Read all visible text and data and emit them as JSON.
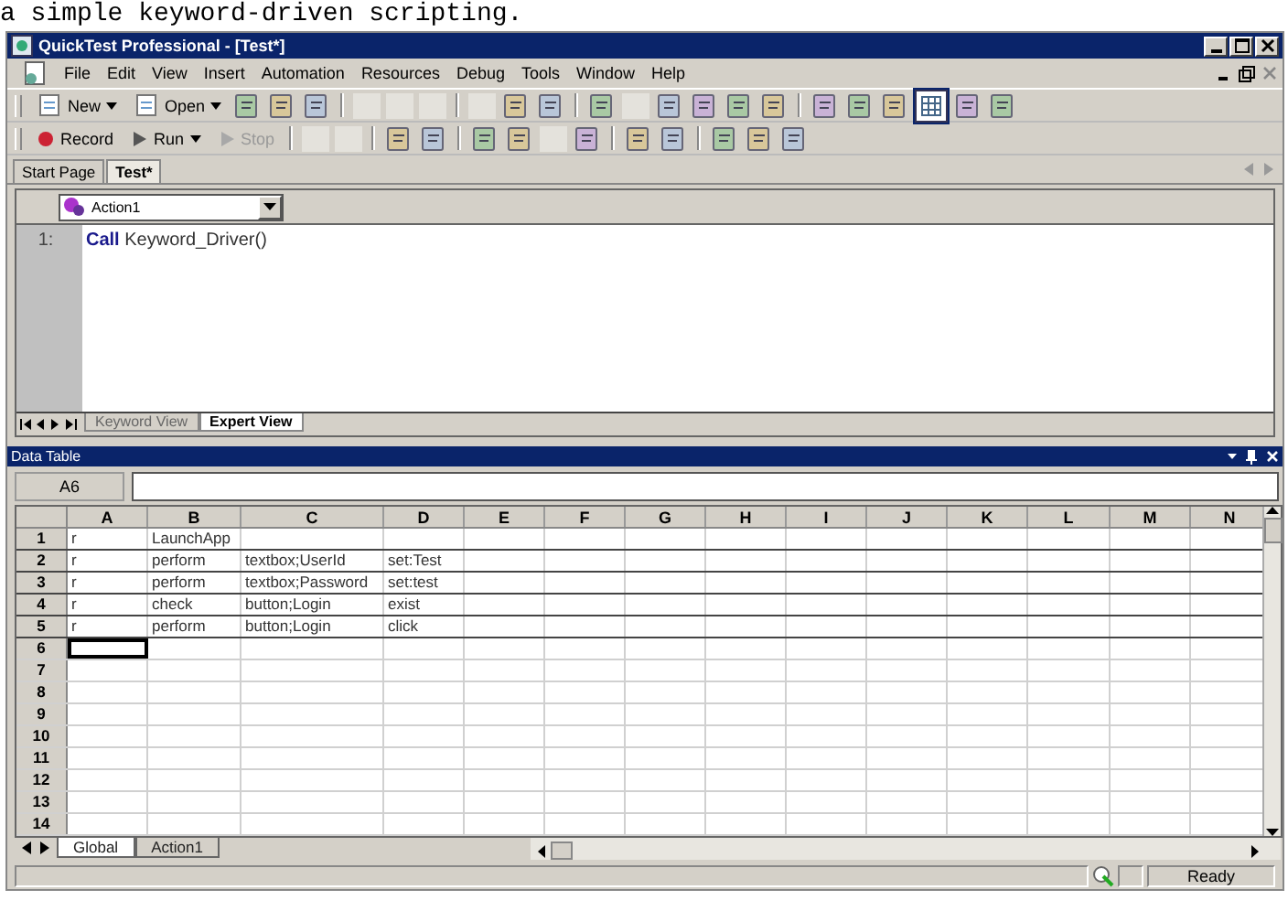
{
  "caption": "a simple keyword-driven scripting.",
  "window": {
    "title": "QuickTest Professional - [Test*]"
  },
  "menu": [
    "File",
    "Edit",
    "View",
    "Insert",
    "Automation",
    "Resources",
    "Debug",
    "Tools",
    "Window",
    "Help"
  ],
  "toolbars": [
    [
      {
        "kind": "button",
        "label": "New",
        "dropdown": true,
        "disabled": false
      },
      {
        "kind": "button",
        "label": "Open",
        "dropdown": true,
        "disabled": false
      },
      {
        "kind": "icon"
      },
      {
        "kind": "icon"
      },
      {
        "kind": "icon"
      },
      {
        "kind": "sep"
      },
      {
        "kind": "blank"
      },
      {
        "kind": "blank"
      },
      {
        "kind": "blank"
      },
      {
        "kind": "sep"
      },
      {
        "kind": "blank"
      },
      {
        "kind": "icon"
      },
      {
        "kind": "icon"
      },
      {
        "kind": "sep"
      },
      {
        "kind": "icon"
      },
      {
        "kind": "blank"
      },
      {
        "kind": "icon"
      },
      {
        "kind": "icon"
      },
      {
        "kind": "icon"
      },
      {
        "kind": "icon"
      },
      {
        "kind": "sep"
      },
      {
        "kind": "icon"
      },
      {
        "kind": "icon"
      },
      {
        "kind": "icon"
      },
      {
        "kind": "grid"
      },
      {
        "kind": "icon"
      },
      {
        "kind": "icon"
      }
    ],
    [
      {
        "kind": "button",
        "label": "Record",
        "dropdown": false,
        "disabled": false
      },
      {
        "kind": "button",
        "label": "Run",
        "dropdown": true,
        "disabled": false
      },
      {
        "kind": "button",
        "label": "Stop",
        "dropdown": false,
        "disabled": true
      },
      {
        "kind": "sep"
      },
      {
        "kind": "blank"
      },
      {
        "kind": "blank"
      },
      {
        "kind": "sep"
      },
      {
        "kind": "icon"
      },
      {
        "kind": "icon"
      },
      {
        "kind": "sep"
      },
      {
        "kind": "icon"
      },
      {
        "kind": "icon"
      },
      {
        "kind": "blank"
      },
      {
        "kind": "icon"
      },
      {
        "kind": "sep"
      },
      {
        "kind": "icon"
      },
      {
        "kind": "icon"
      },
      {
        "kind": "sep"
      },
      {
        "kind": "icon"
      },
      {
        "kind": "icon"
      },
      {
        "kind": "icon"
      }
    ]
  ],
  "doc_tabs": [
    {
      "label": "Start Page",
      "selected": false
    },
    {
      "label": "Test*",
      "selected": true
    }
  ],
  "action_select": {
    "value": "Action1"
  },
  "editor": {
    "lines": [
      {
        "number": "1:",
        "keyword": "Call",
        "code": "Keyword_Driver()"
      }
    ]
  },
  "view_tabs": [
    {
      "label": "Keyword View",
      "selected": false
    },
    {
      "label": "Expert View",
      "selected": true
    }
  ],
  "data_table": {
    "title": "Data Table",
    "name_box": "A6",
    "columns": [
      "A",
      "B",
      "C",
      "D",
      "E",
      "F",
      "G",
      "H",
      "I",
      "J",
      "K",
      "L",
      "M",
      "N"
    ],
    "rows": [
      {
        "number": "1",
        "selected": false,
        "cells": [
          "r",
          "LaunchApp"
        ]
      },
      {
        "number": "2",
        "selected": false,
        "cells": [
          "r",
          "perform",
          "textbox;UserId",
          "set:Test"
        ]
      },
      {
        "number": "3",
        "selected": false,
        "cells": [
          "r",
          "perform",
          "textbox;Password",
          "set:test"
        ]
      },
      {
        "number": "4",
        "selected": false,
        "cells": [
          "r",
          "check",
          "button;Login",
          "exist"
        ]
      },
      {
        "number": "5",
        "selected": false,
        "cells": [
          "r",
          "perform",
          "button;Login",
          "click"
        ]
      },
      {
        "number": "6",
        "selected": true
      },
      {
        "number": "7",
        "selected": false
      },
      {
        "number": "8",
        "selected": false
      },
      {
        "number": "9",
        "selected": false
      },
      {
        "number": "10",
        "selected": false
      },
      {
        "number": "11",
        "selected": false
      },
      {
        "number": "12",
        "selected": false
      },
      {
        "number": "13",
        "selected": false
      },
      {
        "number": "14",
        "selected": false
      }
    ],
    "sheet_tabs": [
      {
        "label": "Global",
        "selected": true
      },
      {
        "label": "Action1",
        "selected": false
      }
    ]
  },
  "status_bar": {
    "text": "Ready"
  }
}
